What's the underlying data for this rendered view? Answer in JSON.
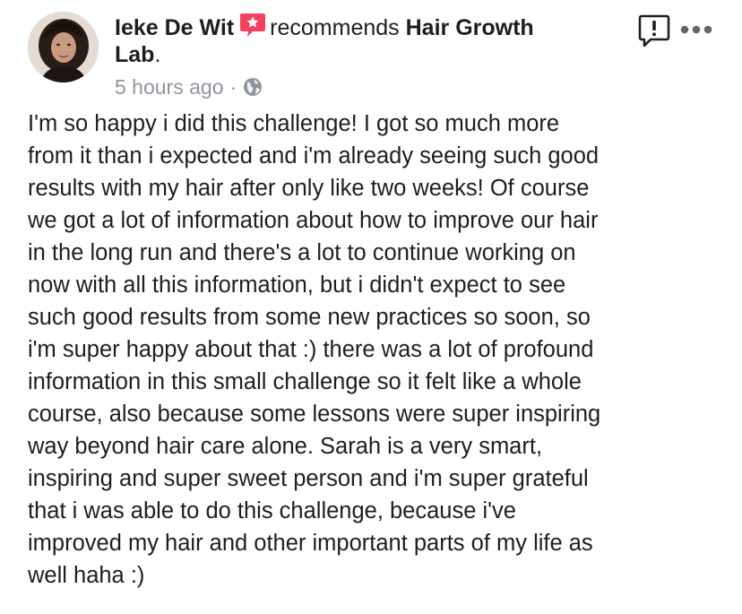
{
  "post": {
    "author": "Ieke De Wit",
    "verb": "recommends",
    "page_name": "Hair Growth",
    "page_name_line2": "Lab",
    "page_name_suffix": ".",
    "timestamp": "5 hours ago",
    "separator": "·",
    "privacy_icon": "globe-icon",
    "body": "I'm so happy i did this challenge! I got so much more\nfrom it than i expected and i'm already seeing such good\nresults with my hair after only like two weeks! Of course\nwe got a lot of information about how to improve our hair\nin the long run and there's a lot to continue working on\nnow with all this information, but i didn't expect to see\nsuch good results from some new practices so soon, so\ni'm super happy about that :) there was a lot of profound\ninformation in this small challenge so it felt like a whole\ncourse, also because some lessons were super inspiring\nway beyond hair care alone. Sarah is a very smart,\ninspiring and super sweet person and i'm super grateful\nthat i was able to do this challenge, because i've\nimproved my hair and other important parts of my life as\nwell haha :)"
  },
  "icons": {
    "recommend": "star-speech-bubble-icon",
    "report": "report-exclamation-icon",
    "more": "more-options-icon"
  },
  "colors": {
    "recommend_badge": "#f3425f",
    "meta_text": "#90949c",
    "body_text": "#1c1e21"
  }
}
